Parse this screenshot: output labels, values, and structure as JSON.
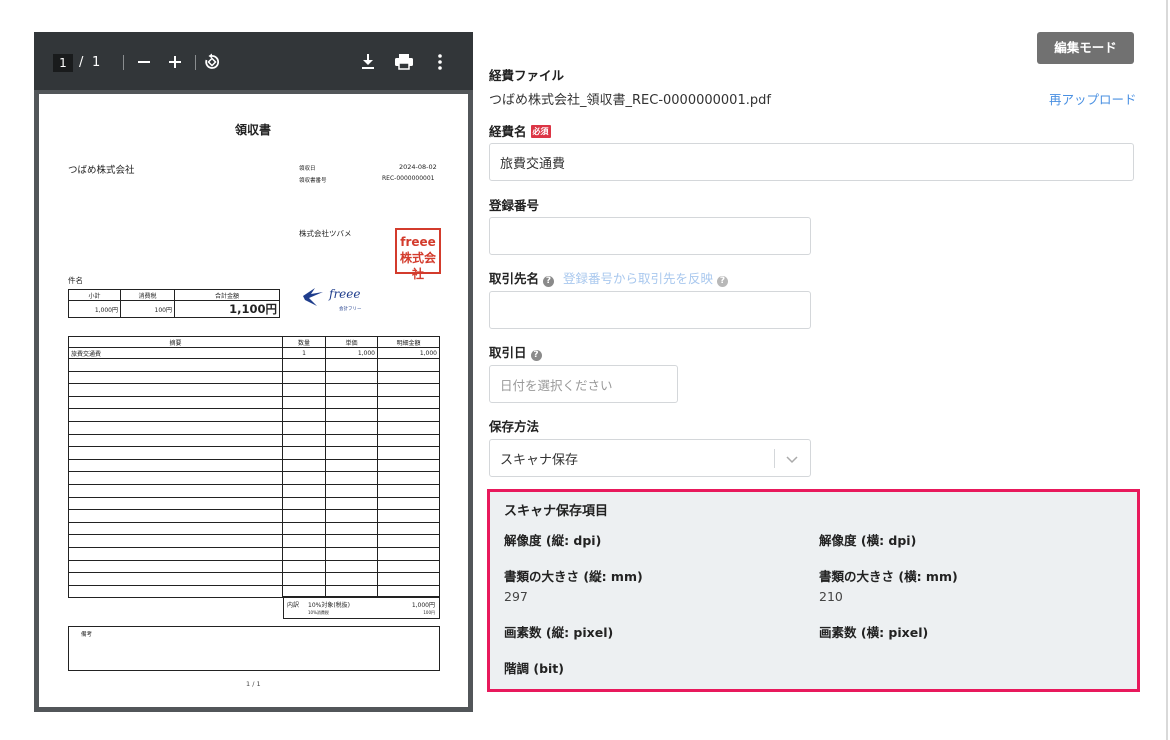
{
  "viewer": {
    "page_current": "1",
    "page_sep": "/",
    "page_total": "1",
    "icons": [
      "minus-icon",
      "plus-icon",
      "rotate-icon",
      "download-icon",
      "print-icon",
      "more-vert-icon"
    ]
  },
  "receipt": {
    "title": "領収書",
    "recipient": "つばめ株式会社",
    "date_label": "領収日",
    "date_value": "2024-08-02",
    "number_label": "領収書番号",
    "number_value": "REC-0000000001",
    "issuer": "株式会社ツバメ",
    "stamp_text": "freee 株式会社",
    "logo_text": "freee",
    "logo_sub": "会計フリー",
    "subject_label": "件名",
    "summary_headers": [
      "小計",
      "消費税",
      "合計金額"
    ],
    "summary_values": [
      "1,000円",
      "100円",
      "1,100円"
    ],
    "items_headers": [
      "摘要",
      "数量",
      "単価",
      "明細金額"
    ],
    "items_row": [
      "旅費交通費",
      "1",
      "1,000",
      "1,000"
    ],
    "breakdown_label": "内訳",
    "breakdown_text": "10%対象(税抜)",
    "breakdown_value": "1,000円",
    "breakdown_sub": "10%消費税",
    "breakdown_sub_value": "100円",
    "remarks_label": "備考",
    "page_footer": "1 / 1"
  },
  "form": {
    "edit_mode_button": "編集モード",
    "file_label": "経費ファイル",
    "file_name": "つばめ株式会社_領収書_REC-0000000001.pdf",
    "reupload_link": "再アップロード",
    "expense_name_label": "経費名",
    "required_badge": "必須",
    "expense_name_value": "旅費交通費",
    "registration_label": "登録番号",
    "registration_value": "",
    "partner_label": "取引先名",
    "partner_link": "登録番号から取引先を反映",
    "partner_value": "",
    "date_label": "取引日",
    "date_placeholder": "日付を選択ください",
    "storage_label": "保存方法",
    "storage_value": "スキャナ保存",
    "help_icon_glyph": "?"
  },
  "scanner": {
    "title": "スキャナ保存項目",
    "res_v_label": "解像度 (縦: dpi)",
    "res_v_value": "",
    "res_h_label": "解像度 (横: dpi)",
    "res_h_value": "",
    "size_v_label": "書類の大きさ (縦: mm)",
    "size_v_value": "297",
    "size_h_label": "書類の大きさ (横: mm)",
    "size_h_value": "210",
    "pix_v_label": "画素数 (縦: pixel)",
    "pix_v_value": "",
    "pix_h_label": "画素数 (横: pixel)",
    "pix_h_value": "",
    "depth_label": "階調 (bit)",
    "depth_value": "",
    "highlight_color": "#e8195c"
  }
}
